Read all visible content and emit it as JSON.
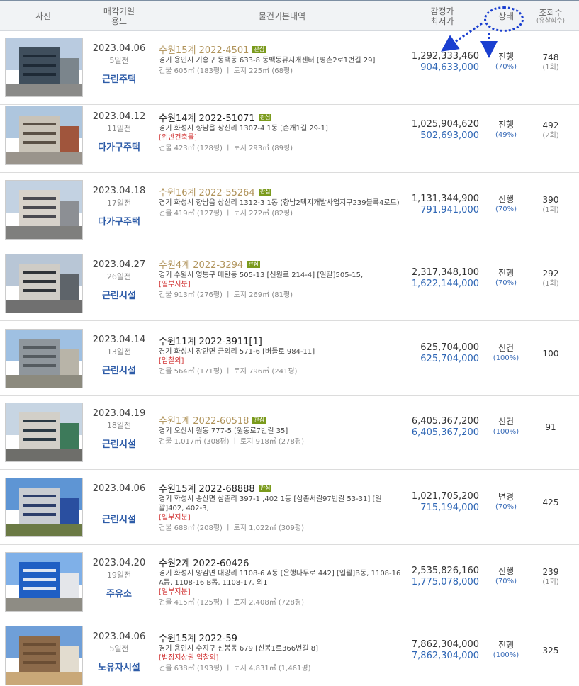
{
  "header": {
    "photo": "사진",
    "date_usage_1": "매각기일",
    "date_usage_2": "용도",
    "basic_info": "물건기본내역",
    "price_1": "감정가",
    "price_2": "최저가",
    "status": "상태",
    "views_1": "조회수",
    "views_2": "(유찰회수)"
  },
  "colors": {
    "header_bg": "#f1f3f5",
    "usage_blue": "#2e5ca8",
    "min_price_blue": "#2e66b5",
    "interest_tag": "#7a9a1c",
    "gold_case": "#b0935a",
    "warning_red": "#d03030",
    "annotation_blue": "#1a3fd0"
  },
  "rows": [
    {
      "date": "2023.04.06",
      "dday": "5일전",
      "usage": "근린주택",
      "case": "수원15계 2022-4501",
      "gold": true,
      "tag": "관심",
      "address": "경기 용인시 기흥구 동백동 633-8 동백동뮤지개센터 [평촌2로1번길 29]",
      "warning": "",
      "area": "건물 605㎡ (183평)  ㅣ  토지 225㎡ (68평)",
      "appraisal": "1,292,333,460",
      "minimum": "904,633,000",
      "status": "진행",
      "percent": "(70%)",
      "views": "748",
      "fails": "(1회)",
      "photo": {
        "sky": "#b9cbe0",
        "ground": "#8a8a88",
        "bldg": "#3f4e5c",
        "bldg2": "#7b858c",
        "win": "#1e2a36"
      }
    },
    {
      "date": "2023.04.12",
      "dday": "11일전",
      "usage": "다가구주택",
      "case": "수원14계 2022-51071",
      "gold": false,
      "tag": "관심",
      "address": "경기 화성시 향남읍 상신리 1307-4 1동 [손개1길 29-1]",
      "warning": "[위반건축물]",
      "area": "건물 423㎡ (128평)  ㅣ  토지 293㎡ (89평)",
      "appraisal": "1,025,904,620",
      "minimum": "502,693,000",
      "status": "진행",
      "percent": "(49%)",
      "views": "492",
      "fails": "(2회)",
      "photo": {
        "sky": "#aec6de",
        "ground": "#9a948c",
        "bldg": "#c9c3b8",
        "bldg2": "#a0553c",
        "win": "#5a5046"
      }
    },
    {
      "date": "2023.04.18",
      "dday": "17일전",
      "usage": "다가구주택",
      "case": "수원16계 2022-55264",
      "gold": true,
      "tag": "관심",
      "address": "경기 화성시 향남읍 상신리 1312-3 1동 (향남2택지개발사업지구239블록4로트)",
      "warning": "",
      "area": "건물 419㎡ (127평)  ㅣ  토지 272㎡ (82평)",
      "appraisal": "1,131,344,900",
      "minimum": "791,941,000",
      "status": "진행",
      "percent": "(70%)",
      "views": "390",
      "fails": "(1회)",
      "photo": {
        "sky": "#c3d2e2",
        "ground": "#7f7f7d",
        "bldg": "#d7d2ca",
        "bldg2": "#8c8f94",
        "win": "#4a4a50"
      }
    },
    {
      "date": "2023.04.27",
      "dday": "26일전",
      "usage": "근린시설",
      "case": "수원4계 2022-3294",
      "gold": true,
      "tag": "관심",
      "address": "경기 수원시 영통구 매탄동 505-13 [신원로 214-4] [일괄]505-15,",
      "warning": "[일부지분]",
      "area": "건물 913㎡ (276평)  ㅣ  토지 269㎡ (81평)",
      "appraisal": "2,317,348,100",
      "minimum": "1,622,144,000",
      "status": "진행",
      "percent": "(70%)",
      "views": "292",
      "fails": "(1회)",
      "photo": {
        "sky": "#b8c6d6",
        "ground": "#707070",
        "bldg": "#cfccc6",
        "bldg2": "#5e646a",
        "win": "#2f3338"
      }
    },
    {
      "date": "2023.04.14",
      "dday": "13일전",
      "usage": "근린시설",
      "case": "수원11계 2022-3911[1]",
      "gold": false,
      "tag": "",
      "address": "경기 화성시 장안면 금의리 571-6 [버들로 984-11]",
      "warning": "[입찰외]",
      "area": "건물 564㎡ (171평)  ㅣ  토지 796㎡ (241평)",
      "appraisal": "625,704,000",
      "minimum": "625,704,000",
      "status": "신건",
      "percent": "(100%)",
      "views": "100",
      "fails": "",
      "photo": {
        "sky": "#9fc0e2",
        "ground": "#8c8a7e",
        "bldg": "#8f969c",
        "bldg2": "#b8b4a8",
        "win": "#555b60"
      }
    },
    {
      "date": "2023.04.19",
      "dday": "18일전",
      "usage": "근린시설",
      "case": "수원1계 2022-60518",
      "gold": true,
      "tag": "관심",
      "address": "경기 오산시 원동 777-5 [원동로7번길 35]",
      "warning": "",
      "area": "건물 1,017㎡ (308평)  ㅣ  토지 918㎡ (278평)",
      "appraisal": "6,405,367,200",
      "minimum": "6,405,367,200",
      "status": "신건",
      "percent": "(100%)",
      "views": "91",
      "fails": "",
      "photo": {
        "sky": "#c7d5e3",
        "ground": "#6e6e6a",
        "bldg": "#d2cfc8",
        "bldg2": "#3d7a5a",
        "win": "#2c3a44"
      }
    },
    {
      "date": "2023.04.06",
      "dday": "",
      "usage": "근린시설",
      "case": "수원15계 2022-68888",
      "gold": false,
      "tag": "관심",
      "address": "경기 화성시 송산면 삼존리 397-1 ,402 1동 [삼존서길97번길 53-31] [일괄]402, 402-3,",
      "warning": "[일부지분]",
      "area": "건물 688㎡ (208평)  ㅣ  토지 1,022㎡ (309평)",
      "appraisal": "1,021,705,200",
      "minimum": "715,194,000",
      "status": "변경",
      "percent": "(70%)",
      "views": "425",
      "fails": "",
      "photo": {
        "sky": "#5e95d4",
        "ground": "#6b7a45",
        "bldg": "#c9cdd2",
        "bldg2": "#2a4fa0",
        "win": "#2c3e6a"
      }
    },
    {
      "date": "2023.04.20",
      "dday": "19일전",
      "usage": "주유소",
      "case": "수원2계 2022-60426",
      "gold": false,
      "tag": "",
      "address": "경기 화성시 양감면 대양리 1108-6 A동 [은행나무로 442] [일괄]B동, 1108-16 A동, 1108-16 B동, 1108-17, 외1",
      "warning": "[일부지분]",
      "area": "건물 415㎡ (125평)  ㅣ  토지 2,408㎡ (728평)",
      "appraisal": "2,535,826,160",
      "minimum": "1,775,078,000",
      "status": "진행",
      "percent": "(70%)",
      "views": "239",
      "fails": "(1회)",
      "photo": {
        "sky": "#7fb0e8",
        "ground": "#8e8c84",
        "bldg": "#1f5fc4",
        "bldg2": "#e4e6ea",
        "win": "#dfe6f2"
      }
    },
    {
      "date": "2023.04.06",
      "dday": "5일전",
      "usage": "노유자시설",
      "case": "수원15계 2022-59",
      "gold": false,
      "tag": "",
      "address": "경기 용인시 수지구 신봉동 679 [신봉1로366번길 8]",
      "warning": "[법정지상권  입찰외]",
      "area": "건물 638㎡ (193평)  ㅣ  토지 4,831㎡ (1,461평)",
      "appraisal": "7,862,304,000",
      "minimum": "7,862,304,000",
      "status": "진행",
      "percent": "(100%)",
      "views": "325",
      "fails": "",
      "photo": {
        "sky": "#6f9fd8",
        "ground": "#c9a878",
        "bldg": "#8c6a4a",
        "bldg2": "#e2dccf",
        "win": "#6b4e34"
      }
    }
  ]
}
